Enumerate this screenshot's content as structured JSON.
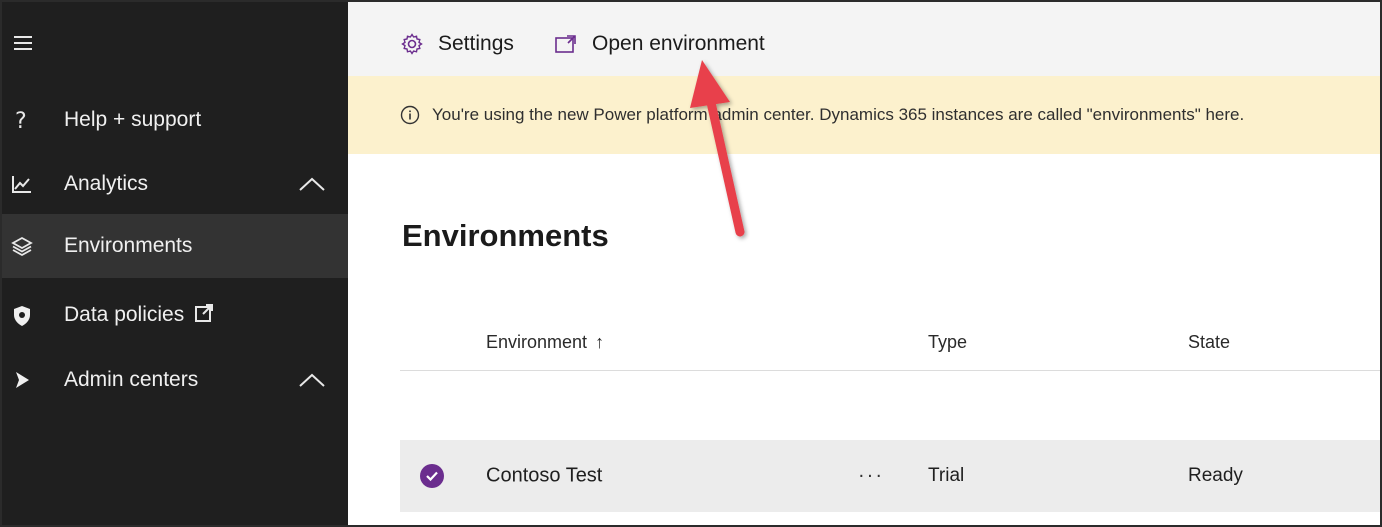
{
  "sidebar": {
    "items": [
      {
        "label": "Help + support",
        "icon": "help-icon"
      },
      {
        "label": "Analytics",
        "icon": "analytics-chart-icon",
        "expanded": true
      },
      {
        "label": "Environments",
        "icon": "layers-icon",
        "selected": true
      },
      {
        "label": "Data policies",
        "icon": "shield-icon",
        "external": true
      },
      {
        "label": "Admin centers",
        "icon": "dynamics-icon",
        "expanded": true
      }
    ]
  },
  "toolbar": {
    "settings_label": "Settings",
    "open_environment_label": "Open environment"
  },
  "banner": {
    "text": "You're using the new Power platform admin center. Dynamics 365 instances are called \"environments\" here."
  },
  "page": {
    "title": "Environments"
  },
  "table": {
    "columns": [
      "Environment",
      "Type",
      "State"
    ],
    "sort_indicator": "↑",
    "rows": [
      {
        "name": "Contoso Test",
        "more": "···",
        "type": "Trial",
        "state": "Ready",
        "selected": true
      }
    ]
  },
  "colors": {
    "sidebar_bg": "#1f1f1f",
    "selected_nav_bg": "#333333",
    "banner_bg": "#fcf1cd",
    "accent_purple": "#6b2d8e",
    "annotation_arrow": "#e8414b"
  }
}
